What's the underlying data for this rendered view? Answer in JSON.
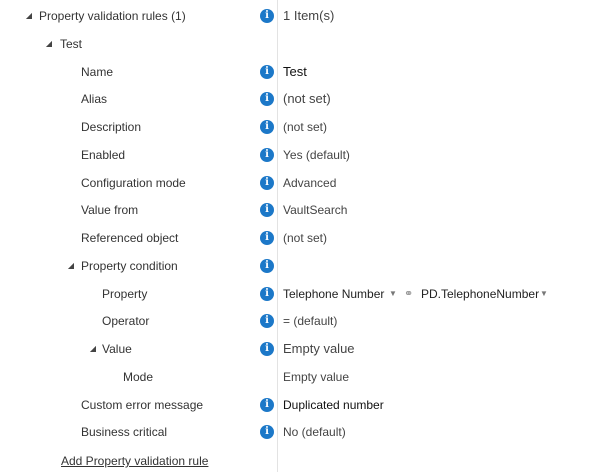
{
  "rules": {
    "label": "Property validation rules (1)",
    "value": "1 Item(s)",
    "expanded_icon": "expanded-triangle"
  },
  "rule": {
    "label": "Test",
    "fields": {
      "name": {
        "label": "Name",
        "value": "Test"
      },
      "alias": {
        "label": "Alias",
        "value": "(not set)"
      },
      "description": {
        "label": "Description",
        "value": "(not set)"
      },
      "enabled": {
        "label": "Enabled",
        "value": "Yes (default)"
      },
      "configuration_mode": {
        "label": "Configuration mode",
        "value": "Advanced"
      },
      "value_from": {
        "label": "Value from",
        "value": "VaultSearch"
      },
      "referenced_object": {
        "label": "Referenced object",
        "value": "(not set)"
      }
    },
    "property_condition": {
      "label": "Property condition",
      "property": {
        "label": "Property",
        "display_name": "Telephone Number",
        "internal_name": "PD.TelephoneNumber"
      },
      "operator": {
        "label": "Operator",
        "value": "= (default)"
      },
      "value": {
        "label": "Value",
        "value": "Empty value",
        "mode": {
          "label": "Mode",
          "value": "Empty value"
        }
      }
    },
    "custom_error_message": {
      "label": "Custom error message",
      "value": "Duplicated number"
    },
    "business_critical": {
      "label": "Business critical",
      "value": "No (default)"
    }
  },
  "add_link": "Add Property validation rule",
  "icons": {
    "info": "info-icon",
    "link": "link-icon",
    "dropdown": "dropdown-arrow-icon"
  },
  "colors": {
    "info": "#1c78c8",
    "divider": "#e3e3e3"
  }
}
